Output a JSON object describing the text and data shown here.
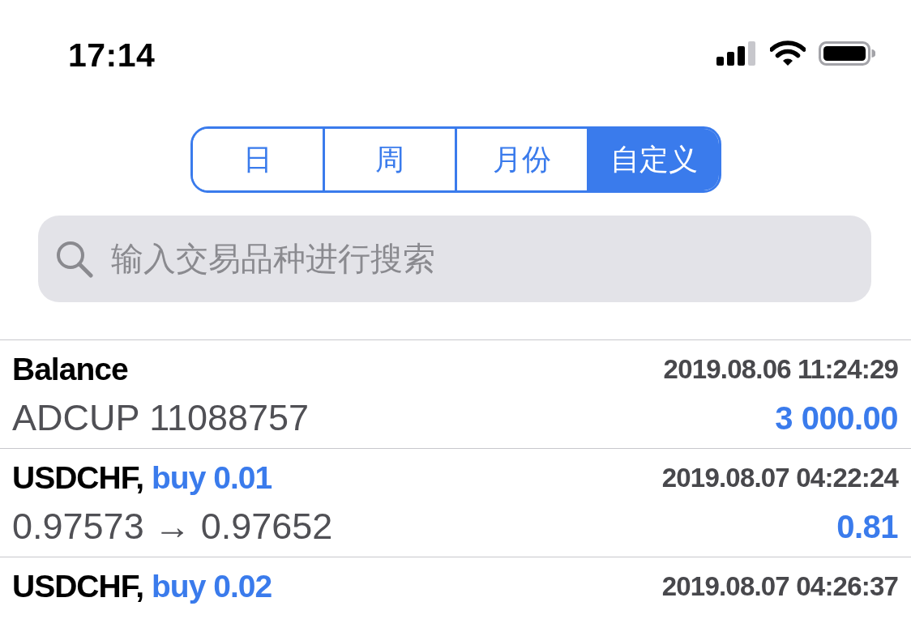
{
  "status_bar": {
    "time": "17:14"
  },
  "tabs": [
    {
      "label": "日",
      "selected": false
    },
    {
      "label": "周",
      "selected": false
    },
    {
      "label": "月份",
      "selected": false
    },
    {
      "label": "自定义",
      "selected": true
    }
  ],
  "search": {
    "placeholder": "输入交易品种进行搜索"
  },
  "deals": [
    {
      "kind": "balance",
      "title": "Balance",
      "time": "2019.08.06 11:24:29",
      "detail": "ADCUP 11088757",
      "amount": "3 000.00"
    },
    {
      "kind": "trade",
      "title": "USDCHF,",
      "action": "buy 0.01",
      "time": "2019.08.07 04:22:24",
      "detail": "0.97573 → 0.97652",
      "amount": "0.81"
    },
    {
      "kind": "trade",
      "title": "USDCHF,",
      "action": "buy 0.02",
      "time": "2019.08.07 04:26:37"
    }
  ]
}
